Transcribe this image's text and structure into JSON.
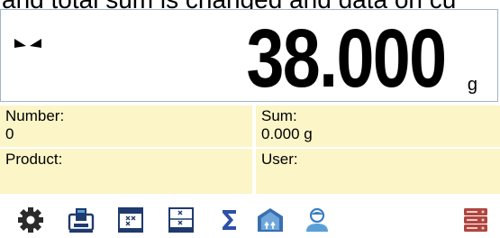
{
  "caption": "and total sum is changed and data on cu",
  "weighing": {
    "value": "38.000",
    "unit": "g"
  },
  "info": {
    "number_label": "Number:",
    "number_value": "0",
    "sum_label": "Sum:",
    "sum_value": "0.000 g",
    "product_label": "Product:",
    "user_label": "User:"
  },
  "toolbar": {
    "icons": [
      "gear-icon",
      "printer-icon",
      "records-icon",
      "statistics-icon",
      "sigma-icon",
      "packaging-icon",
      "user-icon",
      "database-icon"
    ]
  },
  "colors": {
    "info_bg": "#fbf5c8",
    "icon_dark": "#1f3a6e",
    "icon_light": "#5aa0d8",
    "sigma": "#2f4fa8",
    "database": "#b0453f"
  }
}
